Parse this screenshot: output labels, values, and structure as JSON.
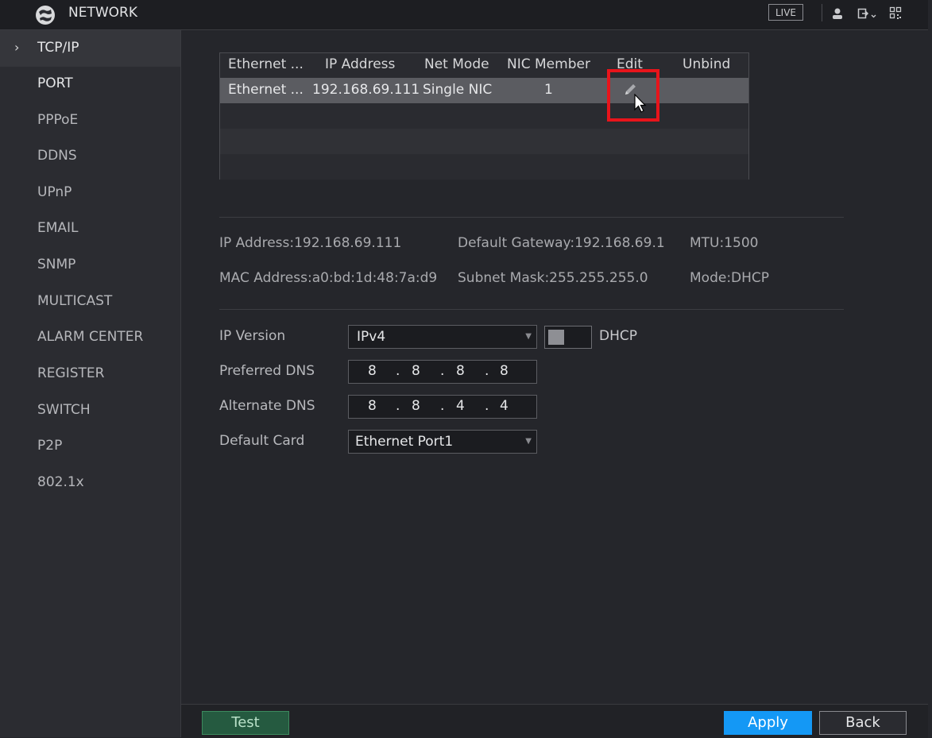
{
  "header": {
    "title": "NETWORK",
    "live_label": "LIVE",
    "icons": [
      "network-logo-icon",
      "user-icon",
      "logout-icon",
      "qr-code-icon"
    ]
  },
  "sidebar": {
    "items": [
      {
        "label": "TCP/IP",
        "active": true
      },
      {
        "label": "PORT"
      },
      {
        "label": "PPPoE"
      },
      {
        "label": "DDNS"
      },
      {
        "label": "UPnP"
      },
      {
        "label": "EMAIL"
      },
      {
        "label": "SNMP"
      },
      {
        "label": "MULTICAST"
      },
      {
        "label": "ALARM CENTER"
      },
      {
        "label": "REGISTER"
      },
      {
        "label": "SWITCH"
      },
      {
        "label": "P2P"
      },
      {
        "label": "802.1x"
      }
    ]
  },
  "nic_table": {
    "columns": [
      "Ethernet ...",
      "IP Address",
      "Net Mode",
      "NIC Member",
      "Edit",
      "Unbind"
    ],
    "rows": [
      {
        "ethernet": "Ethernet ...",
        "ip": "192.168.69.111",
        "net_mode": "Single NIC",
        "nic_member": "1"
      }
    ]
  },
  "info": {
    "ip_address": "IP Address:192.168.69.111",
    "default_gateway": "Default Gateway:192.168.69.1",
    "mtu": "MTU:1500",
    "mac_address": "MAC Address:a0:bd:1d:48:7a:d9",
    "subnet_mask": "Subnet Mask:255.255.255.0",
    "mode": "Mode:DHCP"
  },
  "form": {
    "ip_version_label": "IP Version",
    "ip_version_value": "IPv4",
    "dhcp_label": "DHCP",
    "dhcp_enabled": false,
    "preferred_dns_label": "Preferred DNS",
    "preferred_dns": [
      "8",
      "8",
      "8",
      "8"
    ],
    "alternate_dns_label": "Alternate DNS",
    "alternate_dns": [
      "8",
      "8",
      "4",
      "4"
    ],
    "default_card_label": "Default Card",
    "default_card_value": "Ethernet Port1"
  },
  "footer": {
    "test_label": "Test",
    "apply_label": "Apply",
    "back_label": "Back"
  },
  "colors": {
    "accent": "#1498f5",
    "highlight": "#e8141b",
    "test_button": "#255a40"
  }
}
